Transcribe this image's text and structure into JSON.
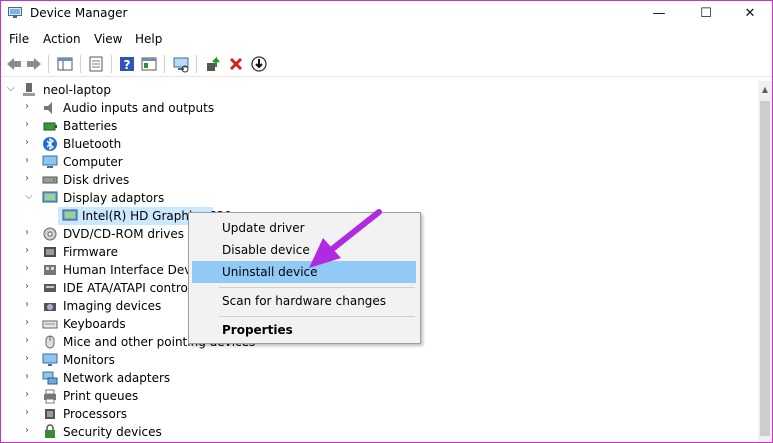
{
  "window": {
    "title": "Device Manager",
    "minimize": "—",
    "maximize": "☐",
    "close": "✕"
  },
  "menu": [
    "File",
    "Action",
    "View",
    "Help"
  ],
  "tree": {
    "root": "neol-laptop",
    "items": [
      {
        "label": "Audio inputs and outputs",
        "icon": "speaker-icon",
        "expanded": false
      },
      {
        "label": "Batteries",
        "icon": "battery-icon",
        "expanded": false
      },
      {
        "label": "Bluetooth",
        "icon": "bluetooth-icon",
        "expanded": false
      },
      {
        "label": "Computer",
        "icon": "computer-icon",
        "expanded": false
      },
      {
        "label": "Disk drives",
        "icon": "disk-drive-icon",
        "expanded": false
      },
      {
        "label": "Display adaptors",
        "icon": "display-adapter-icon",
        "expanded": true
      },
      {
        "label": "Intel(R) HD Graphics 620",
        "icon": "display-adapter-icon",
        "child": true,
        "selected": true
      },
      {
        "label": "DVD/CD-ROM drives",
        "icon": "dvd-drive-icon",
        "expanded": false
      },
      {
        "label": "Firmware",
        "icon": "firmware-icon",
        "expanded": false
      },
      {
        "label": "Human Interface Devices",
        "icon": "hid-icon",
        "expanded": false
      },
      {
        "label": "IDE ATA/ATAPI controllers",
        "icon": "ide-controller-icon",
        "expanded": false
      },
      {
        "label": "Imaging devices",
        "icon": "camera-icon",
        "expanded": false
      },
      {
        "label": "Keyboards",
        "icon": "keyboard-icon",
        "expanded": false
      },
      {
        "label": "Mice and other pointing devices",
        "icon": "mouse-icon",
        "expanded": false
      },
      {
        "label": "Monitors",
        "icon": "monitor-icon",
        "expanded": false
      },
      {
        "label": "Network adapters",
        "icon": "network-adapter-icon",
        "expanded": false
      },
      {
        "label": "Print queues",
        "icon": "printer-icon",
        "expanded": false
      },
      {
        "label": "Processors",
        "icon": "processor-icon",
        "expanded": false
      },
      {
        "label": "Security devices",
        "icon": "security-device-icon",
        "expanded": false
      }
    ]
  },
  "context_menu": {
    "update_driver": "Update driver",
    "disable_device": "Disable device",
    "uninstall_device": "Uninstall device",
    "scan_changes": "Scan for hardware changes",
    "properties": "Properties"
  },
  "colors": {
    "accent_border": "#c236c2",
    "selection": "#cce8ff",
    "menu_highlight": "#91c9f7",
    "annotation_arrow": "#b02be0"
  }
}
